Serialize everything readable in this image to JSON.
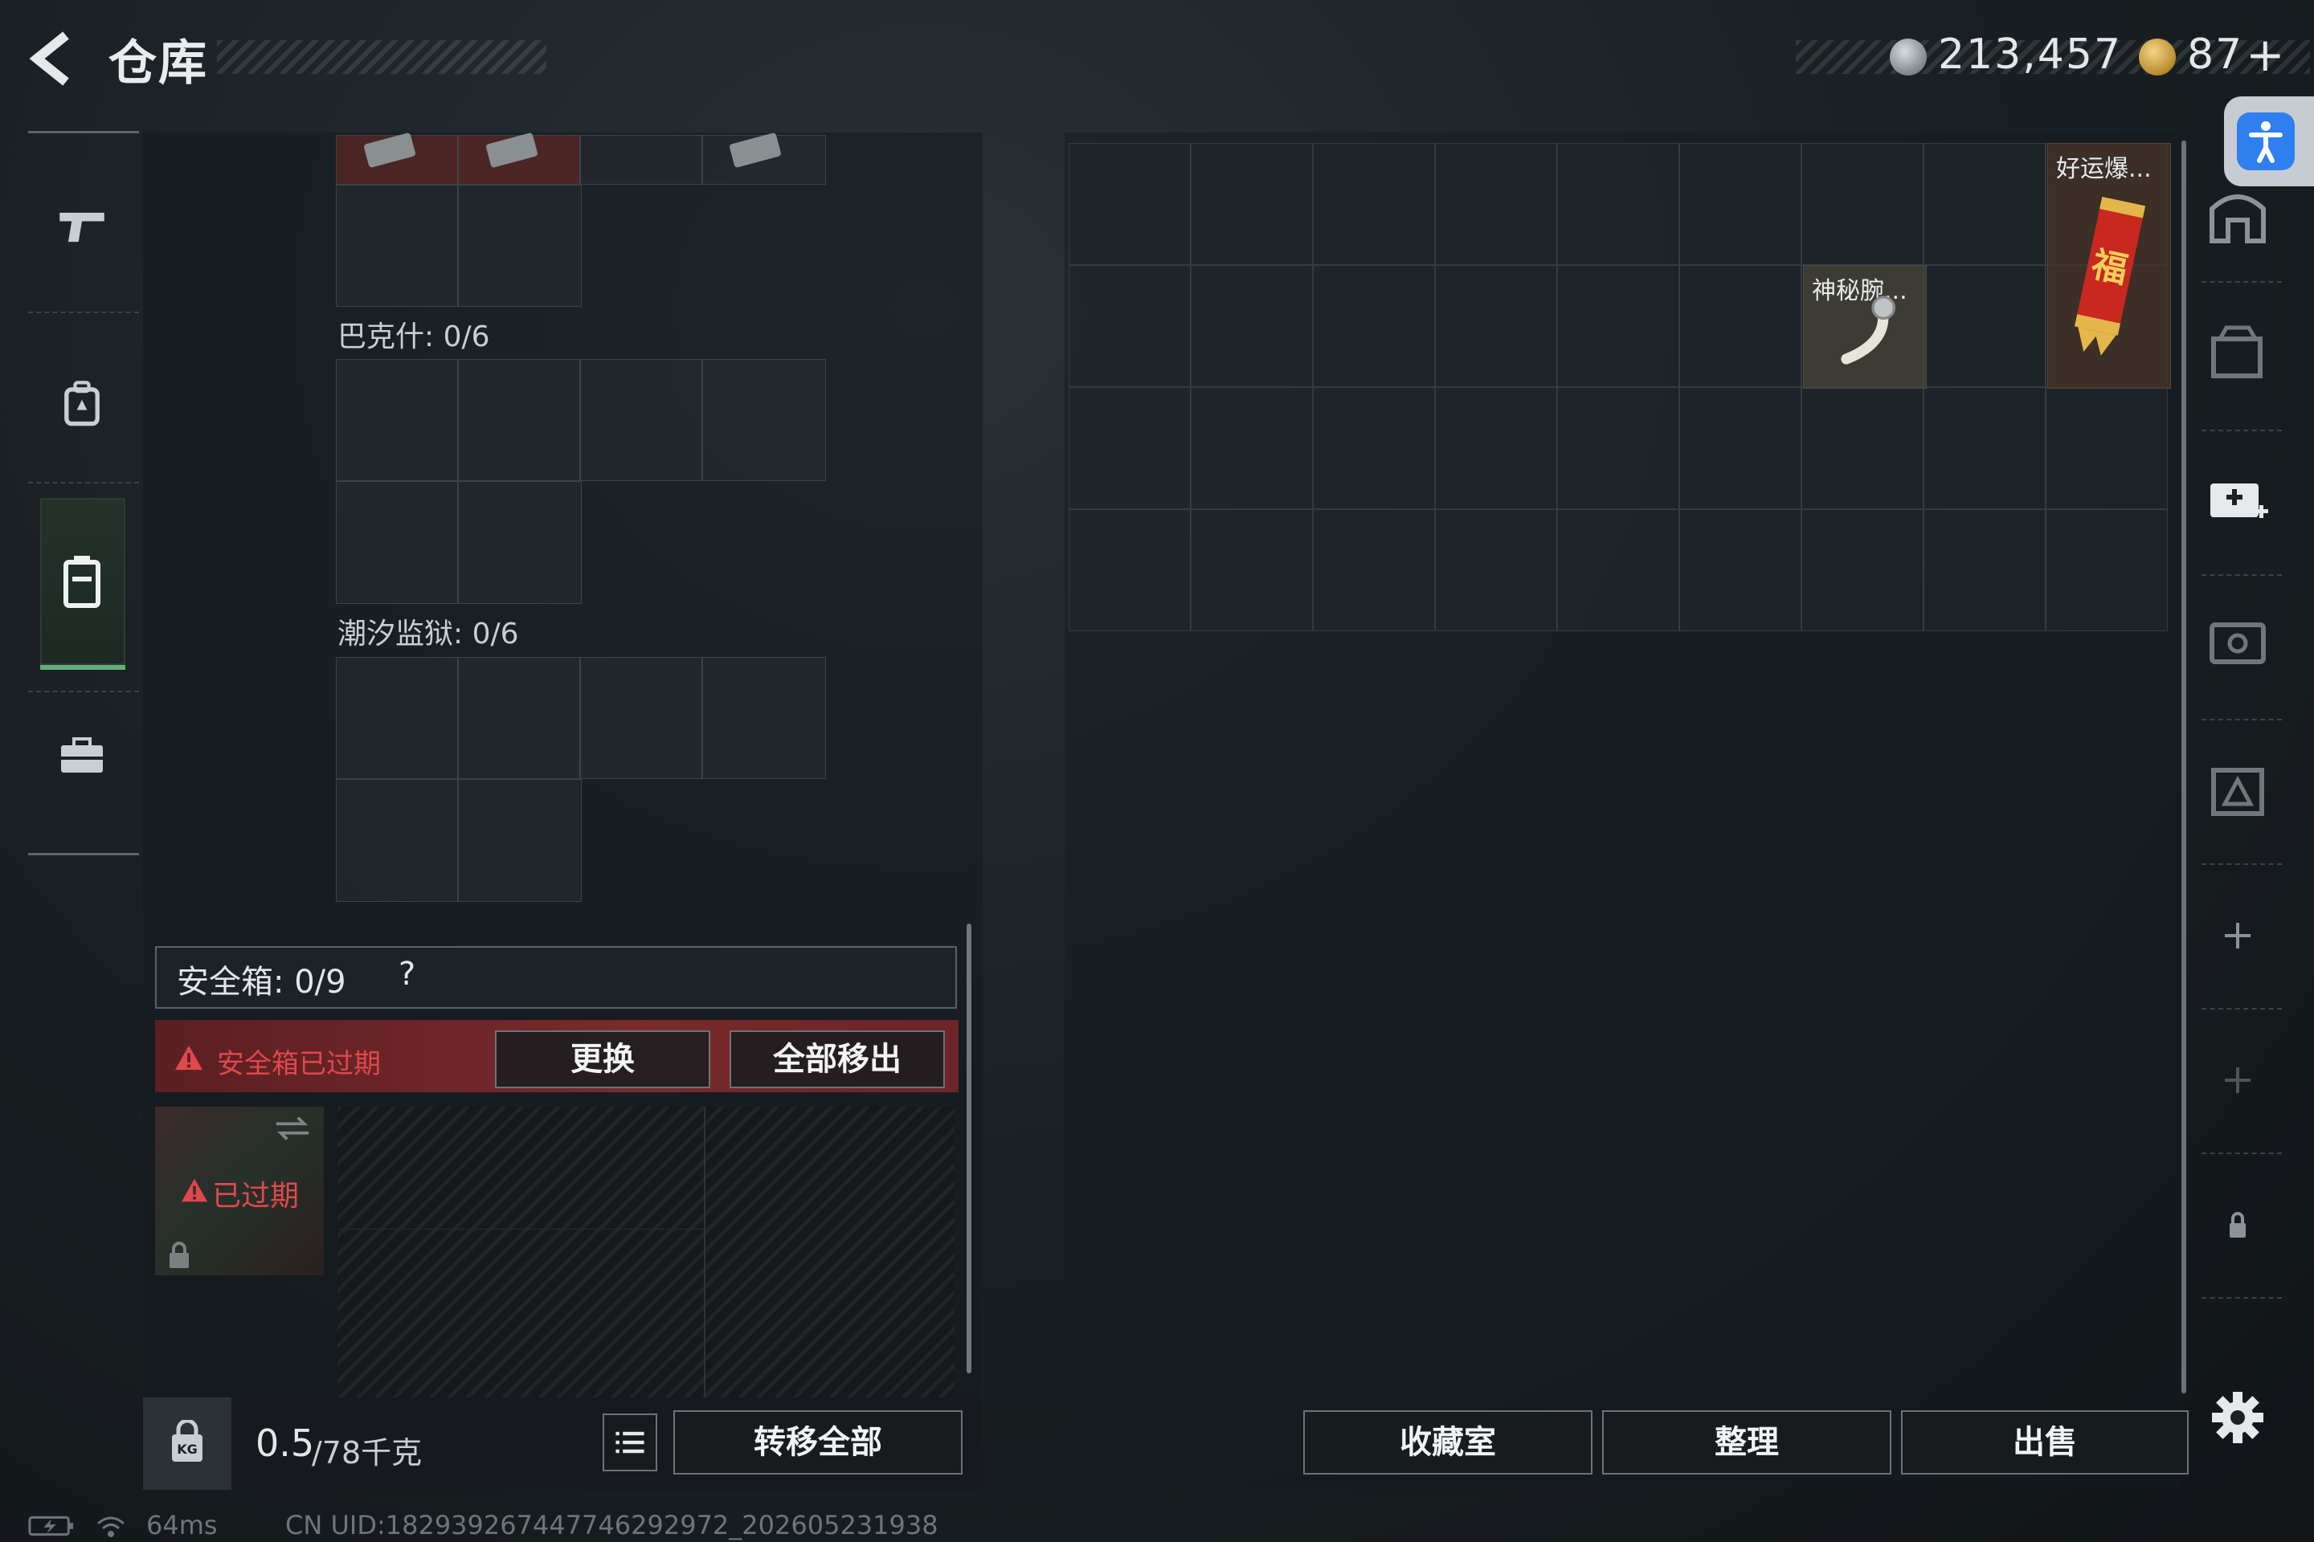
{
  "header": {
    "title": "仓库",
    "currency1": "213,457",
    "currency2": "87",
    "currency2_add": "+"
  },
  "left_nav": {
    "items": [
      {
        "name": "weapon",
        "icon": "pistol-icon"
      },
      {
        "name": "gear",
        "icon": "backpack-icon"
      },
      {
        "name": "container",
        "icon": "case-icon",
        "active": true
      },
      {
        "name": "toolbox",
        "icon": "briefcase-icon"
      }
    ]
  },
  "containers": {
    "bakesh_label": "巴克什: 0/6",
    "tidal_label": "潮汐监狱: 0/6"
  },
  "safe_box": {
    "label": "安全箱: 0/9",
    "help": "?",
    "expired_warning": "安全箱已过期",
    "replace_button": "更换",
    "remove_all_button": "全部移出",
    "card_expired": "已过期"
  },
  "bottom_left": {
    "weight_value": "0.5",
    "weight_unit": "/78千克",
    "transfer_all_button": "转移全部"
  },
  "stash": {
    "items": [
      {
        "label": "神秘腕...",
        "icon": "mystery-bracelet-icon"
      },
      {
        "label": "好运爆...",
        "icon": "lucky-firecracker-icon"
      }
    ],
    "buttons": {
      "collection": "收藏室",
      "organize": "整理",
      "sell": "出售"
    }
  },
  "status_bar": {
    "ping": "64ms",
    "uid": "CN UID:18293926744774629297​2_202605231938"
  },
  "colors": {
    "accent_green": "#5fb07a",
    "warning_red": "#e0484c",
    "accessibility_blue": "#2f7ff0"
  }
}
